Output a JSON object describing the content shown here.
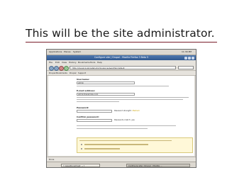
{
  "slide": {
    "title": "This will be the site administrator."
  },
  "screenshot": {
    "panel": {
      "applications": "Applications",
      "places": "Places",
      "system": "System",
      "clock": "11:30 PM"
    },
    "window_title": "Configure site | Drupal - Mozilla Firefox 3 Beta 5",
    "menu": [
      "File",
      "Edit",
      "View",
      "History",
      "Bookmarks",
      "Tools",
      "Help"
    ],
    "url": "http://drupal.local/install.php?locale=en&profile=default",
    "bookmarks": [
      "Drupal Bookmarks",
      "Drupal",
      "Support"
    ],
    "form": {
      "username_label": "Username:",
      "username_value": "admin",
      "email_label": "E-mail address:",
      "email_value": "admin@example.com",
      "password_label": "Password:",
      "password_strength_label": "Password strength:",
      "password_strength_value": "Medium",
      "confirm_label": "Confirm password:",
      "passwords_match_label": "Passwords match:",
      "passwords_match_value": "yes"
    },
    "status": "Done",
    "taskbar": [
      "[ rosie@localhost: ~ ]",
      "Configure site | Drupal - Mozilla ..."
    ]
  },
  "colors": {
    "rule": "#7a1f2b",
    "titlebar": "#3a64a0",
    "notice_background": "#fff8d8",
    "strength_medium": "#c8a000"
  }
}
